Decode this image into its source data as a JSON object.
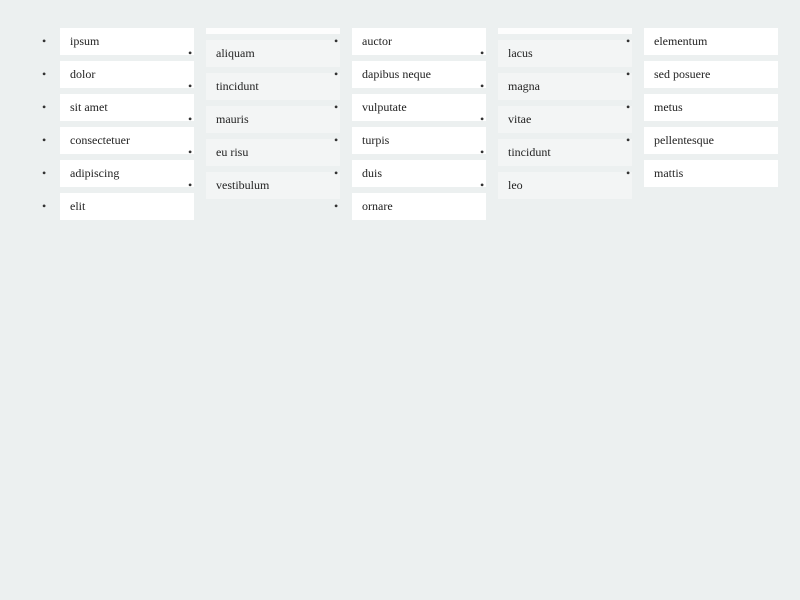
{
  "columns": [
    {
      "hasHeader": false,
      "alt": false,
      "items": [
        "ipsum",
        "dolor",
        "sit amet",
        "consectetuer",
        "adipiscing",
        "elit"
      ]
    },
    {
      "hasHeader": true,
      "alt": true,
      "items": [
        "aliquam",
        "tincidunt",
        "mauris",
        "eu risu",
        "vestibulum"
      ]
    },
    {
      "hasHeader": false,
      "alt": false,
      "items": [
        "auctor",
        "dapibus neque",
        "vulputate",
        "turpis",
        "duis",
        "ornare"
      ]
    },
    {
      "hasHeader": true,
      "alt": true,
      "items": [
        "lacus",
        "magna",
        "vitae",
        "tincidunt",
        "leo"
      ]
    },
    {
      "hasHeader": false,
      "alt": false,
      "items": [
        "elementum",
        "sed posuere",
        "metus",
        "pellentesque",
        "mattis"
      ]
    }
  ]
}
